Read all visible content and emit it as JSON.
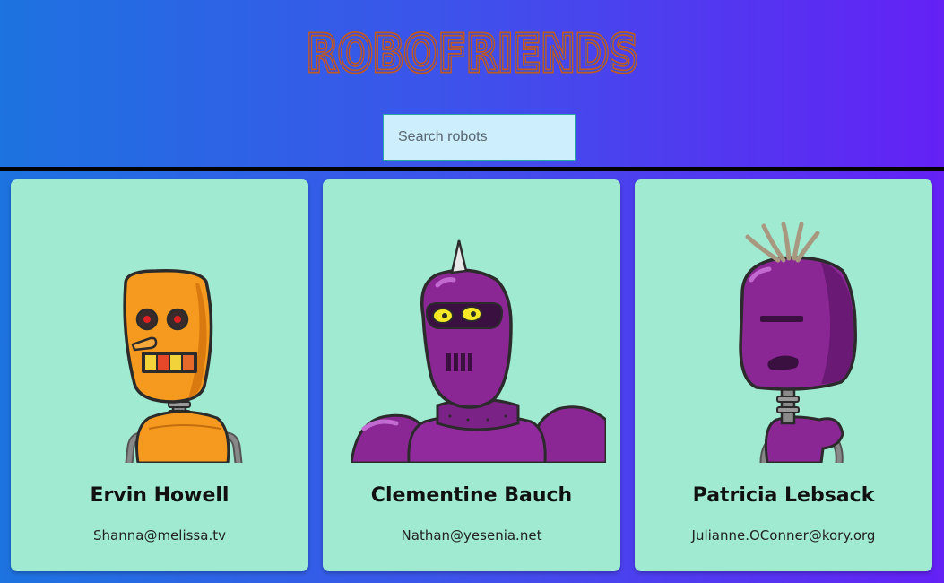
{
  "app": {
    "title": "ROBOFRIENDS",
    "title_color": "#c05a1e"
  },
  "search": {
    "placeholder": "Search robots",
    "value": ""
  },
  "colors": {
    "card_background": "#9fead1",
    "search_background": "#cdeefc",
    "gradient_start": "#1d73e0",
    "gradient_end": "#6421f5"
  },
  "robots": [
    {
      "name": "Ervin Howell",
      "email": "Shanna@melissa.tv",
      "color": "orange"
    },
    {
      "name": "Clementine Bauch",
      "email": "Nathan@yesenia.net",
      "color": "purple"
    },
    {
      "name": "Patricia Lebsack",
      "email": "Julianne.OConner@kory.org",
      "color": "purple"
    }
  ]
}
